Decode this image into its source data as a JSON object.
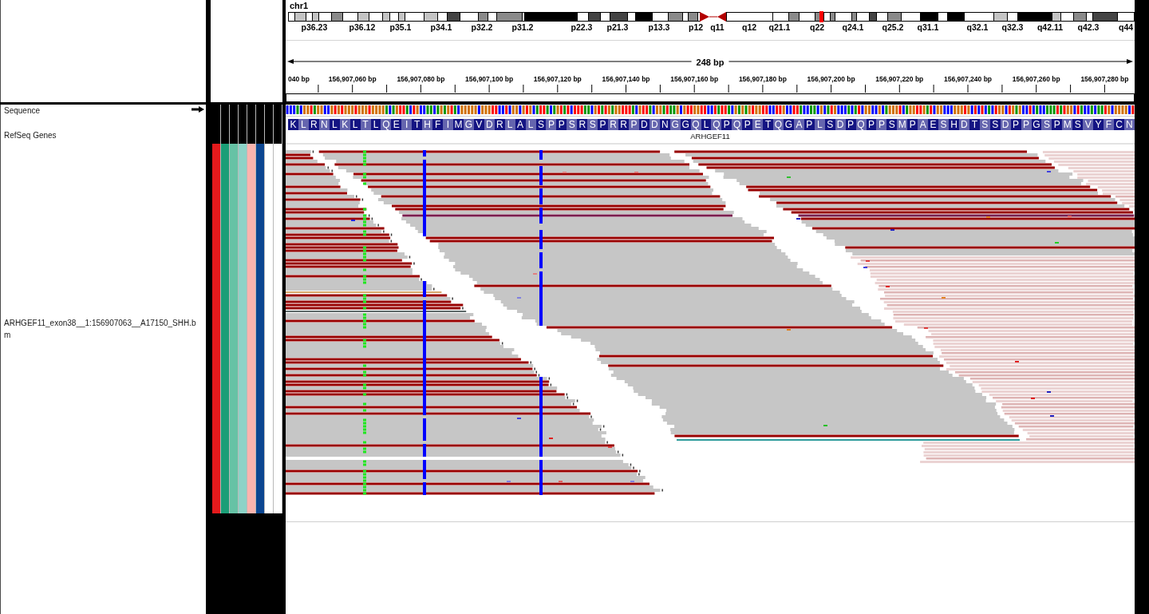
{
  "chromosome": {
    "name": "chr1",
    "bands": [
      "p36.23",
      "p36.12",
      "p35.1",
      "p34.1",
      "p32.2",
      "p31.2",
      "p22.3",
      "p21.3",
      "p13.3",
      "p12",
      "q11",
      "q12",
      "q21.1",
      "q22",
      "q24.1",
      "q25.2",
      "q31.1",
      "q32.1",
      "q32.3",
      "q42.11",
      "q42.3",
      "q44"
    ]
  },
  "ruler": {
    "span": "248 bp",
    "ticks": [
      "040 bp",
      "156,907,060 bp",
      "156,907,080 bp",
      "156,907,100 bp",
      "156,907,120 bp",
      "156,907,140 bp",
      "156,907,160 bp",
      "156,907,180 bp",
      "156,907,200 bp",
      "156,907,220 bp",
      "156,907,240 bp",
      "156,907,260 bp",
      "156,907,280 bp"
    ]
  },
  "tracks": [
    {
      "kind": "sequence",
      "name": "Sequence",
      "forward": true
    },
    {
      "kind": "genes",
      "name": "RefSeq Genes",
      "gene": "ARHGEF11",
      "amino_acids": [
        "K",
        "L",
        "R",
        "N",
        "L",
        "K",
        "L",
        "T",
        "L",
        "Q",
        "E",
        "I",
        "T",
        "H",
        "F",
        "I",
        "M",
        "G",
        "V",
        "D",
        "R",
        "L",
        "A",
        "L",
        "S",
        "P",
        "P",
        "S",
        "R",
        "S",
        "P",
        "R",
        "R",
        "P",
        "D",
        "D",
        "N",
        "G",
        "G",
        "Q",
        "L",
        "Q",
        "P",
        "Q",
        "P",
        "E",
        "T",
        "Q",
        "G",
        "A",
        "P",
        "L",
        "S",
        "D",
        "P",
        "Q",
        "P",
        "P",
        "S",
        "M",
        "P",
        "A",
        "E",
        "S",
        "H",
        "D",
        "T",
        "S",
        "S",
        "D",
        "P",
        "P",
        "G",
        "S",
        "P",
        "M",
        "S",
        "V",
        "Y",
        "F",
        "C",
        "N"
      ]
    },
    {
      "kind": "alignment",
      "name_lines": [
        "ARHGEF11_exon38__1:156907063__A17150_SHH.b",
        "m"
      ],
      "attributes": [
        {
          "color": "#e41a1c"
        },
        {
          "color": "#1b9e77"
        },
        {
          "color": "#66c2a5"
        },
        {
          "color": "#8dd3c7"
        },
        {
          "color": "#fbb4ae"
        },
        {
          "color": "#0c4691"
        },
        {
          "color": "#ffffff"
        },
        {
          "color": "#ffffff"
        }
      ]
    }
  ]
}
